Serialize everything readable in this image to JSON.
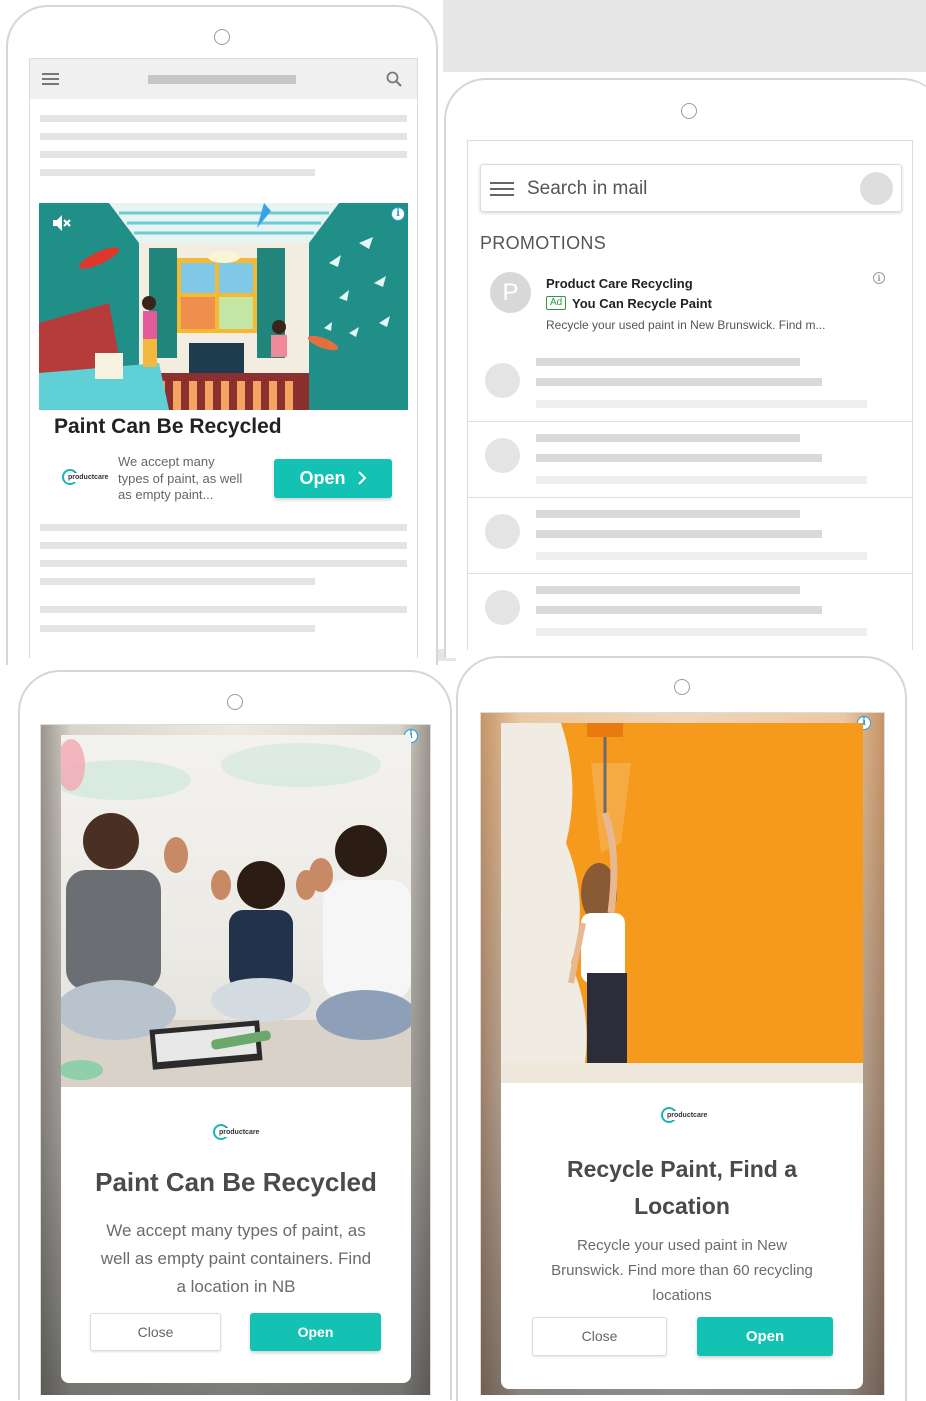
{
  "colors": {
    "accent_teal": "#13c2b3",
    "info_blue": "#2b9bd8",
    "placeholder_gray": "#e4e4e4",
    "orange_wall": "#f59a1c",
    "teal_room": "#1f8f88"
  },
  "phone1": {
    "icons": [
      "hamburger-icon",
      "search-icon",
      "mute-icon",
      "info-icon"
    ],
    "ad": {
      "headline": "Paint Can Be Recycled",
      "body": "We accept many types of paint, as well as empty paint...",
      "body_lines": [
        "We accept many",
        "types of paint, as well",
        "as empty paint..."
      ],
      "cta": "Open",
      "cta_icon": "chevron-right-icon",
      "logo_text": "productcare"
    }
  },
  "phone2": {
    "search_placeholder": "Search in mail",
    "section_label": "PROMOTIONS",
    "promo": {
      "avatar_letter": "P",
      "sender": "Product Care Recycling",
      "ad_badge": "Ad",
      "subject": "You Can Recycle Paint",
      "snippet": "Recycle your used paint in New Brunswick. Find m..."
    }
  },
  "phone3": {
    "logo_text": "productcare",
    "headline": "Paint Can Be Recycled",
    "body_lines": [
      "We accept many types of paint, as",
      "well as empty paint containers. Find",
      "a location in NB"
    ],
    "close_label": "Close",
    "open_label": "Open"
  },
  "phone4": {
    "logo_text": "productcare",
    "headline_lines": [
      "Recycle Paint, Find a",
      "Location"
    ],
    "body_lines": [
      "Recycle your used paint in New",
      "Brunswick. Find more than 60 recycling",
      "locations"
    ],
    "close_label": "Close",
    "open_label": "Open"
  }
}
